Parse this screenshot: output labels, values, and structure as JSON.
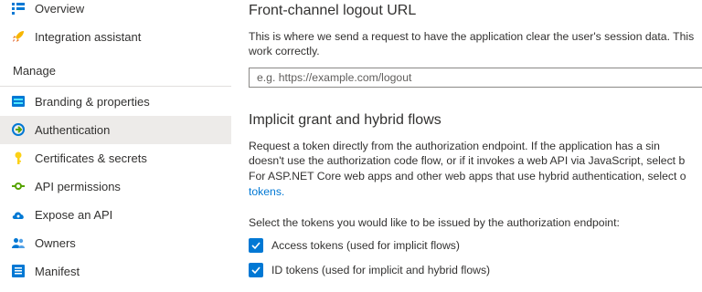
{
  "sidebar": {
    "items_top": [
      {
        "label": "Overview",
        "icon": "overview-icon"
      },
      {
        "label": "Integration assistant",
        "icon": "rocket-icon"
      }
    ],
    "section_label": "Manage",
    "items": [
      {
        "label": "Branding & properties",
        "icon": "branding-icon"
      },
      {
        "label": "Authentication",
        "icon": "authentication-icon",
        "selected": true
      },
      {
        "label": "Certificates & secrets",
        "icon": "key-icon"
      },
      {
        "label": "API permissions",
        "icon": "api-permissions-icon"
      },
      {
        "label": "Expose an API",
        "icon": "cloud-icon"
      },
      {
        "label": "Owners",
        "icon": "owners-icon"
      },
      {
        "label": "Manifest",
        "icon": "manifest-icon"
      }
    ]
  },
  "main": {
    "logout": {
      "title": "Front-channel logout URL",
      "desc_line1": "This is where we send a request to have the application clear the user's session data. This",
      "desc_line2": "work correctly.",
      "placeholder": "e.g. https://example.com/logout"
    },
    "implicit": {
      "title": "Implicit grant and hybrid flows",
      "desc_line1": "Request a token directly from the authorization endpoint. If the application has a sin",
      "desc_line2": "doesn't use the authorization code flow, or if it invokes a web API via JavaScript, select b",
      "desc_line3": "For ASP.NET Core web apps and other web apps that use hybrid authentication, select o",
      "link": "tokens.",
      "select_prompt": "Select the tokens you would like to be issued by the authorization endpoint:",
      "checkboxes": [
        {
          "label": "Access tokens (used for implicit flows)",
          "checked": true
        },
        {
          "label": "ID tokens (used for implicit and hybrid flows)",
          "checked": true
        }
      ]
    }
  },
  "colors": {
    "accent": "#0078d4",
    "selected_bg": "#edebe9"
  }
}
